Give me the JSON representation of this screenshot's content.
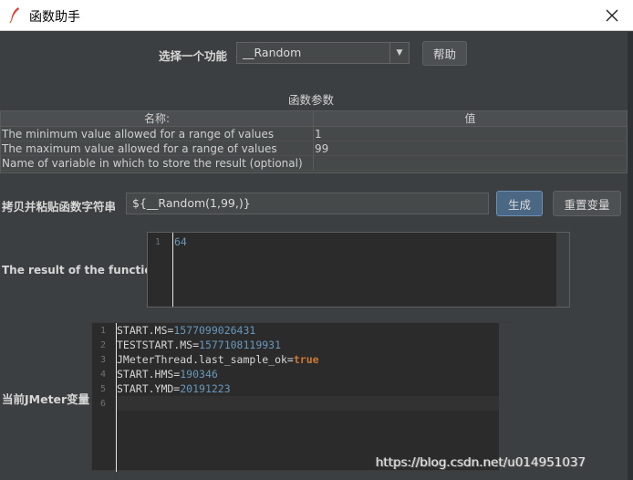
{
  "window": {
    "title": "函数助手"
  },
  "function_select": {
    "label": "选择一个功能",
    "value": "__Random",
    "help_button": "帮助"
  },
  "params": {
    "section_title": "函数参数",
    "headers": {
      "name": "名称:",
      "value": "值"
    },
    "rows": [
      {
        "name": "The minimum value allowed for a range of values",
        "value": "1"
      },
      {
        "name": "The maximum value allowed for a range of values",
        "value": "99"
      },
      {
        "name": "Name of variable in which to store the result (optional)",
        "value": ""
      }
    ]
  },
  "function_string": {
    "label": "拷贝并粘贴函数字符串",
    "value": "${__Random(1,99,)}",
    "generate_button": "生成",
    "reset_button": "重置变量"
  },
  "result": {
    "label": "The result of the function is",
    "line_number": "1",
    "value": "64"
  },
  "jmeter_vars": {
    "label": "当前JMeter变量",
    "lines": [
      {
        "num": "1",
        "key": "START.MS=",
        "val": "1577099026431",
        "type": "num"
      },
      {
        "num": "2",
        "key": "TESTSTART.MS=",
        "val": "1577108119931",
        "type": "num"
      },
      {
        "num": "3",
        "key": "JMeterThread.last_sample_ok=",
        "val": "true",
        "type": "kw"
      },
      {
        "num": "4",
        "key": "START.HMS=",
        "val": "190346",
        "type": "num"
      },
      {
        "num": "5",
        "key": "START.YMD=",
        "val": "20191223",
        "type": "num"
      },
      {
        "num": "6",
        "key": "",
        "val": "",
        "type": "num"
      }
    ]
  },
  "watermark": "https://blog.csdn.net/u014951037"
}
